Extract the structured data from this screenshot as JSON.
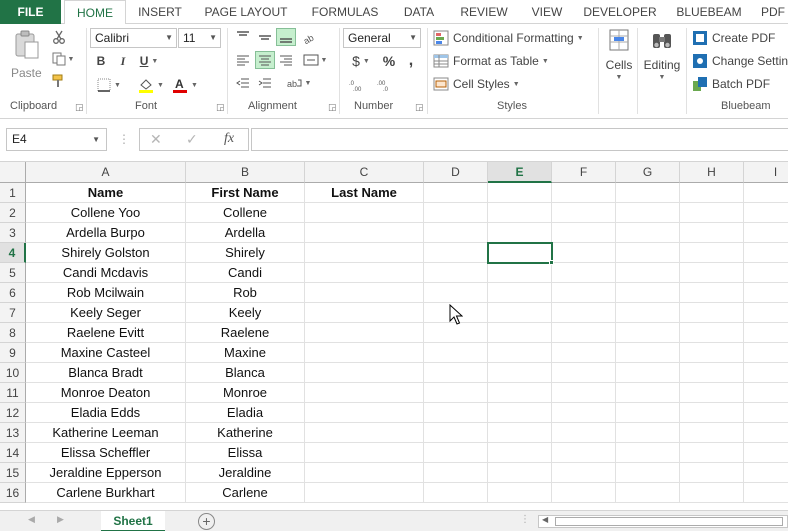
{
  "tabs": [
    "FILE",
    "HOME",
    "INSERT",
    "PAGE LAYOUT",
    "FORMULAS",
    "DATA",
    "REVIEW",
    "VIEW",
    "DEVELOPER",
    "BLUEBEAM",
    "PDF"
  ],
  "ribbon": {
    "clipboard": {
      "paste_label": "Paste",
      "group_label": "Clipboard"
    },
    "font": {
      "font_name": "Calibri",
      "font_size": "11",
      "group_label": "Font"
    },
    "alignment": {
      "group_label": "Alignment"
    },
    "number": {
      "format": "General",
      "currency": "$",
      "percent": "%",
      "comma": ",",
      "group_label": "Number"
    },
    "styles": {
      "conditional": "Conditional Formatting",
      "table": "Format as Table",
      "cell_styles": "Cell Styles",
      "group_label": "Styles"
    },
    "cells": {
      "label": "Cells"
    },
    "editing": {
      "label": "Editing"
    },
    "bluebeam": {
      "create": "Create PDF",
      "change": "Change Settings",
      "batch": "Batch PDF",
      "group_label": "Bluebeam"
    }
  },
  "formula_bar": {
    "name_box": "E4",
    "fx": "fx",
    "value": ""
  },
  "columns": [
    "A",
    "B",
    "C",
    "D",
    "E",
    "F",
    "G",
    "H",
    "I"
  ],
  "rows": [
    "1",
    "2",
    "3",
    "4",
    "5",
    "6",
    "7",
    "8",
    "9",
    "10",
    "11",
    "12",
    "13",
    "14",
    "15",
    "16"
  ],
  "cells": [
    [
      "Name",
      "First Name",
      "Last Name"
    ],
    [
      "Collene Yoo",
      "Collene",
      ""
    ],
    [
      "Ardella Burpo",
      "Ardella",
      ""
    ],
    [
      "Shirely Golston",
      "Shirely",
      ""
    ],
    [
      "Candi Mcdavis",
      "Candi",
      ""
    ],
    [
      "Rob Mcilwain",
      "Rob",
      ""
    ],
    [
      "Keely Seger",
      "Keely",
      ""
    ],
    [
      "Raelene Evitt",
      "Raelene",
      ""
    ],
    [
      "Maxine Casteel",
      "Maxine",
      ""
    ],
    [
      "Blanca Bradt",
      "Blanca",
      ""
    ],
    [
      "Monroe Deaton",
      "Monroe",
      ""
    ],
    [
      "Eladia Edds",
      "Eladia",
      ""
    ],
    [
      "Katherine Leeman",
      "Katherine",
      ""
    ],
    [
      "Elissa Scheffler",
      "Elissa",
      ""
    ],
    [
      "Jeraldine Epperson",
      "Jeraldine",
      ""
    ],
    [
      "Carlene Burkhart",
      "Carlene",
      ""
    ]
  ],
  "sheet_tabs": [
    "Sheet1"
  ],
  "colors": {
    "accent": "#217346"
  }
}
